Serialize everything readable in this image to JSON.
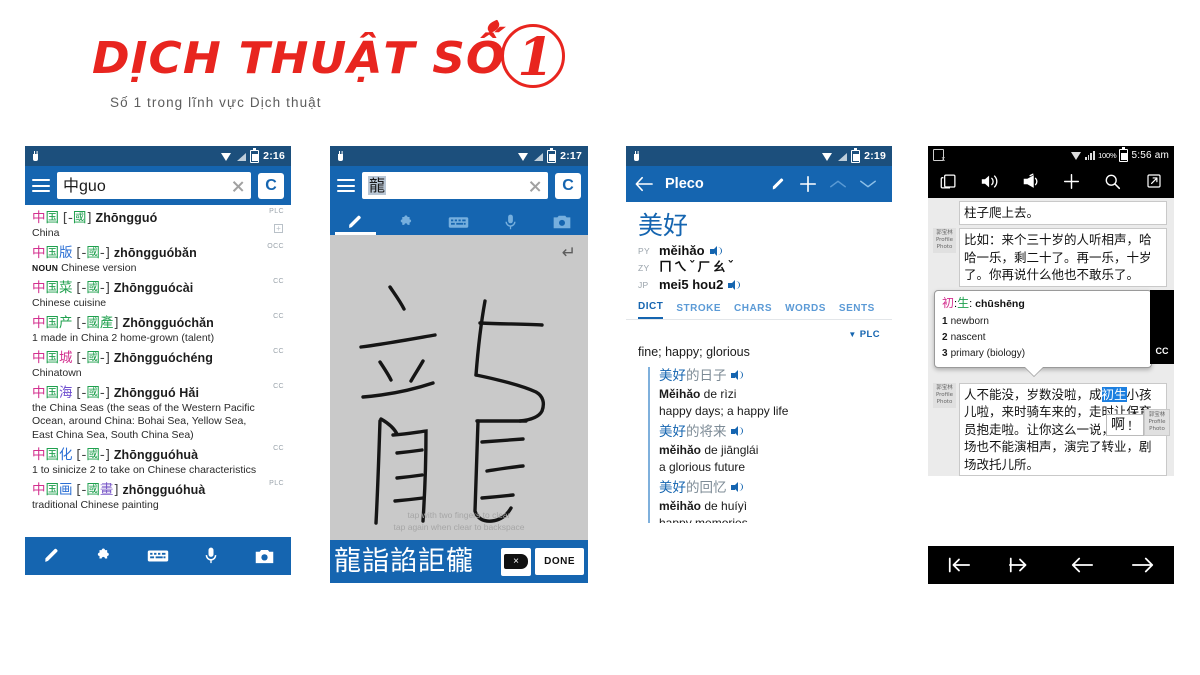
{
  "logo": {
    "word": "DỊCH THUẬT SỐ",
    "number": "1",
    "tagline": "Số 1 trong lĩnh vực Dịch thuật",
    "color": "#e8251f"
  },
  "shot1": {
    "name": "pleco-search-results",
    "statusbar": {
      "time": "2:16",
      "icons": [
        "plug-icon",
        "wifi-icon",
        "signal-icon",
        "battery-icon"
      ]
    },
    "search": {
      "value_hanzi": "中",
      "value_latin": "guo",
      "placeholder": "",
      "clear_label": "×",
      "dict_button": "C"
    },
    "entries": [
      {
        "chars": [
          {
            "t": "中",
            "tone": "t1"
          },
          {
            "t": "国",
            "tone": "t2"
          }
        ],
        "bracket_pre": "[-",
        "bracket_chars": [
          {
            "t": "國",
            "tone": "t2"
          }
        ],
        "bracket_post": "]",
        "pinyin": "Zhōngguó",
        "pos": "",
        "def": "China",
        "source": "PLC",
        "expandable": true
      },
      {
        "chars": [
          {
            "t": "中",
            "tone": "t1"
          },
          {
            "t": "国",
            "tone": "t2"
          },
          {
            "t": "版",
            "tone": "t4"
          }
        ],
        "bracket_pre": "[-",
        "bracket_chars": [
          {
            "t": "國",
            "tone": "t2"
          }
        ],
        "bracket_post": "-]",
        "pinyin": "zhōngguóbǎn",
        "pos": "NOUN",
        "def": "Chinese version",
        "source": "OCC",
        "expandable": false
      },
      {
        "chars": [
          {
            "t": "中",
            "tone": "t1"
          },
          {
            "t": "国",
            "tone": "t2"
          },
          {
            "t": "菜",
            "tone": "t2"
          }
        ],
        "bracket_pre": "[-",
        "bracket_chars": [
          {
            "t": "國",
            "tone": "t2"
          }
        ],
        "bracket_post": "-]",
        "pinyin": "Zhōngguócài",
        "pos": "",
        "def": "Chinese cuisine",
        "source": "CC",
        "expandable": false
      },
      {
        "chars": [
          {
            "t": "中",
            "tone": "t1"
          },
          {
            "t": "国",
            "tone": "t2"
          },
          {
            "t": "产",
            "tone": "t2"
          }
        ],
        "bracket_pre": "[-",
        "bracket_chars": [
          {
            "t": "國",
            "tone": "t2"
          },
          {
            "t": "產",
            "tone": "t2"
          }
        ],
        "bracket_post": "]",
        "pinyin": "Zhōngguóchǎn",
        "pos": "",
        "def": "1 made in China  2 home-grown (talent)",
        "source": "CC",
        "expandable": false
      },
      {
        "chars": [
          {
            "t": "中",
            "tone": "t1"
          },
          {
            "t": "国",
            "tone": "t2"
          },
          {
            "t": "城",
            "tone": "t1"
          }
        ],
        "bracket_pre": "[-",
        "bracket_chars": [
          {
            "t": "國",
            "tone": "t2"
          }
        ],
        "bracket_post": "-]",
        "pinyin": "Zhōngguóchéng",
        "pos": "",
        "def": "Chinatown",
        "source": "CC",
        "expandable": false
      },
      {
        "chars": [
          {
            "t": "中",
            "tone": "t1"
          },
          {
            "t": "国",
            "tone": "t2"
          },
          {
            "t": "海",
            "tone": "t3"
          }
        ],
        "bracket_pre": "[-",
        "bracket_chars": [
          {
            "t": "國",
            "tone": "t2"
          }
        ],
        "bracket_post": "-]",
        "pinyin": "Zhōngguó Hǎi",
        "pos": "",
        "def": "the China Seas (the seas of the Western Pacific Ocean, around China: Bohai Sea, Yellow Sea, East China Sea, South China Sea)",
        "source": "CC",
        "expandable": false
      },
      {
        "chars": [
          {
            "t": "中",
            "tone": "t1"
          },
          {
            "t": "国",
            "tone": "t2"
          },
          {
            "t": "化",
            "tone": "t4"
          }
        ],
        "bracket_pre": "[-",
        "bracket_chars": [
          {
            "t": "國",
            "tone": "t2"
          }
        ],
        "bracket_post": "-]",
        "pinyin": "Zhōngguóhuà",
        "pos": "",
        "def": "1 to sinicize  2 to take on Chinese characteristics",
        "source": "CC",
        "expandable": false
      },
      {
        "chars": [
          {
            "t": "中",
            "tone": "t1"
          },
          {
            "t": "国",
            "tone": "t2"
          },
          {
            "t": "画",
            "tone": "t4"
          }
        ],
        "bracket_pre": "[-",
        "bracket_chars": [
          {
            "t": "國",
            "tone": "t2"
          },
          {
            "t": "畫",
            "tone": "t5"
          }
        ],
        "bracket_post": "]",
        "pinyin": "zhōngguóhuà",
        "pos": "",
        "def": "traditional Chinese painting",
        "source": "PLC",
        "expandable": false
      }
    ],
    "toolbar": [
      {
        "icon": "brush-icon",
        "label": "Handwriting"
      },
      {
        "icon": "puzzle-icon",
        "label": "Radicals"
      },
      {
        "icon": "keyboard-icon",
        "label": "Keyboard"
      },
      {
        "icon": "microphone-icon",
        "label": "Voice"
      },
      {
        "icon": "camera-icon",
        "label": "Camera"
      }
    ]
  },
  "shot2": {
    "name": "pleco-handwriting-input",
    "statusbar": {
      "time": "2:17"
    },
    "search": {
      "value_hanzi": "龍",
      "clear_label": "×",
      "dict_button": "C"
    },
    "modes": [
      {
        "icon": "brush-icon",
        "label": "Handwriting",
        "selected": true
      },
      {
        "icon": "puzzle-icon",
        "label": "Radicals",
        "selected": false
      },
      {
        "icon": "keyboard-icon",
        "label": "Keyboard",
        "selected": false
      },
      {
        "icon": "microphone-icon",
        "label": "Voice",
        "selected": false
      },
      {
        "icon": "camera-icon",
        "label": "Camera",
        "selected": false
      }
    ],
    "canvas": {
      "drawn_character": "龍",
      "undo_icon": "undo-icon",
      "hint_line1": "tap with two fingers to clear",
      "hint_line2": "tap again when clear to backspace"
    },
    "candidates": [
      "龍",
      "詣",
      "諂",
      "詎",
      "龓"
    ],
    "backspace_label": "×",
    "done_label": "DONE"
  },
  "shot3": {
    "name": "pleco-entry-detail",
    "statusbar": {
      "time": "2:19"
    },
    "appbar": {
      "back_icon": "back-arrow-icon",
      "title": "Pleco",
      "icons": [
        "pencil-icon",
        "plus-icon",
        "chevron-up-icon",
        "chevron-down-icon"
      ]
    },
    "headword": "美好",
    "readings": [
      {
        "tag": "PY",
        "value": "měihǎo",
        "audio": true
      },
      {
        "tag": "ZY",
        "value": "ㄇㄟˇㄏㄠˇ",
        "audio": false
      },
      {
        "tag": "JP",
        "value": "mei5 hou2",
        "audio": true
      }
    ],
    "tabs": [
      {
        "label": "DICT",
        "active": true
      },
      {
        "label": "STROKE",
        "active": false
      },
      {
        "label": "CHARS",
        "active": false
      },
      {
        "label": "WORDS",
        "active": false
      },
      {
        "label": "SENTS",
        "active": false
      }
    ],
    "dict_source": "PLC",
    "definition": "fine; happy; glorious",
    "examples": [
      {
        "hanzi_head": "美好",
        "hanzi_rest": "的日子",
        "audio": true,
        "pinyin_bold": "Měihǎo",
        "pinyin_rest": " de rìzi",
        "english": "happy days; a happy life"
      },
      {
        "hanzi_head": "美好",
        "hanzi_rest": "的将来",
        "audio": true,
        "pinyin_bold": "měihǎo",
        "pinyin_rest": " de jiānglái",
        "english": "a glorious future"
      },
      {
        "hanzi_head": "美好",
        "hanzi_rest": "的回忆",
        "audio": true,
        "pinyin_bold": "měihǎo",
        "pinyin_rest": " de huíyì",
        "english": "happy memories"
      }
    ]
  },
  "shot4": {
    "name": "reader-with-popup-dictionary",
    "statusbar": {
      "battery_pct": "100%",
      "time": "5:56 am",
      "icons": [
        "document-icon",
        "wifi-icon",
        "signal-icon",
        "battery-icon"
      ]
    },
    "toolbar": [
      {
        "icon": "copy-icon",
        "label": "Copy"
      },
      {
        "icon": "speaker-icon",
        "label": "Audio"
      },
      {
        "icon": "megaphone-icon",
        "label": "Announce"
      },
      {
        "icon": "plus-icon",
        "label": "Add"
      },
      {
        "icon": "search-icon",
        "label": "Search"
      },
      {
        "icon": "external-link-icon",
        "label": "Open"
      }
    ],
    "messages": [
      {
        "avatar": "",
        "text": "柱子爬上去。"
      },
      {
        "avatar": "郭宝林\nProfile\nPhoto",
        "text": "比如：来个三十岁的人听相声，哈哈一乐，剩二十了。再一乐，十岁了。你再说什么他也不敢乐了。"
      }
    ],
    "popup": {
      "headword_chars": [
        {
          "t": "初",
          "cls": "r"
        },
        {
          "t": ":",
          "cls": ""
        },
        {
          "t": "生",
          "cls": "gn"
        },
        {
          "t": ":",
          "cls": ""
        }
      ],
      "pinyin": "chūshēng",
      "definitions": [
        {
          "num": "1",
          "text": "newborn"
        },
        {
          "num": "2",
          "text": "nascent"
        },
        {
          "num": "3",
          "text": "primary (biology)"
        }
      ],
      "source_tab": "CC"
    },
    "message_below": {
      "avatar": "郭宝林\nProfile\nPhoto",
      "pre": "人不能没，岁数没啦，成",
      "highlight1": "初",
      "highlight2": "生",
      "post": "小孩儿啦，来时骑车来的，走时让保育员抱走啦。让你这么一说，哪个剧场也不能演相声，演完了转业，剧场改托儿所。"
    },
    "small_box": {
      "hanzi": "啊",
      "mark": "！",
      "avatar": "郭宝林\nProfile\nPhoto"
    },
    "navbar": [
      {
        "icon": "first-page-icon",
        "label": "First"
      },
      {
        "icon": "last-page-icon",
        "label": "Last"
      },
      {
        "icon": "back-arrow-icon",
        "label": "Back"
      },
      {
        "icon": "forward-arrow-icon",
        "label": "Forward"
      }
    ]
  }
}
